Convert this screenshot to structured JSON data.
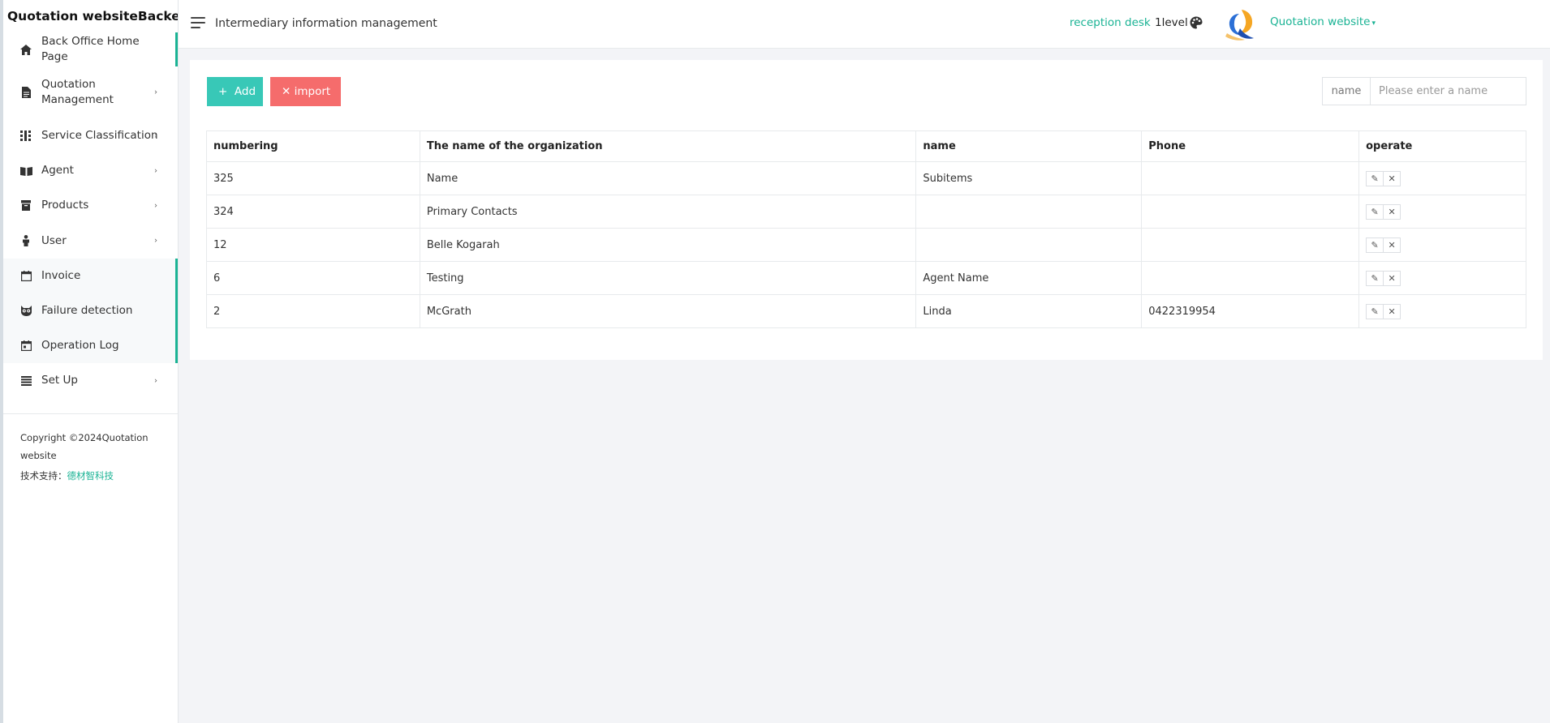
{
  "app": {
    "brand": "Quotation websiteBackend"
  },
  "sidebar": {
    "items": [
      {
        "label": "Back Office Home Page",
        "icon": "home-icon",
        "has_submenu": false
      },
      {
        "label": "Quotation Management",
        "icon": "document-icon",
        "has_submenu": true
      },
      {
        "label": "Service Classification",
        "icon": "columns-icon",
        "has_submenu": true
      },
      {
        "label": "Agent",
        "icon": "book-icon",
        "has_submenu": true
      },
      {
        "label": "Products",
        "icon": "archive-icon",
        "has_submenu": true
      },
      {
        "label": "User",
        "icon": "person-icon",
        "has_submenu": true
      },
      {
        "label": "Invoice",
        "icon": "calendar-icon",
        "has_submenu": false
      },
      {
        "label": "Failure detection",
        "icon": "owl-icon",
        "has_submenu": false
      },
      {
        "label": "Operation Log",
        "icon": "calendar-check-icon",
        "has_submenu": false
      },
      {
        "label": "Set Up",
        "icon": "list-icon",
        "has_submenu": true
      }
    ],
    "copyright": "Copyright ©2024Quotation website",
    "support_label": "技术支持：",
    "support_link": "德材智科技"
  },
  "topbar": {
    "page_title": "Intermediary information management",
    "reception_link": "reception desk",
    "level": "1level",
    "user_menu": "Quotation website"
  },
  "toolbar": {
    "add_label": "Add",
    "import_label": "import",
    "search_label": "name",
    "search_placeholder": "Please enter a name",
    "search_value": ""
  },
  "table": {
    "headers": [
      "numbering",
      "The name of the organization",
      "name",
      "Phone",
      "operate"
    ],
    "rows": [
      {
        "numbering": "325",
        "organization": "Name",
        "name": "Subitems",
        "phone": ""
      },
      {
        "numbering": "324",
        "organization": "Primary Contacts",
        "name": "",
        "phone": ""
      },
      {
        "numbering": "12",
        "organization": "Belle Kogarah",
        "name": "",
        "phone": ""
      },
      {
        "numbering": "6",
        "organization": "Testing",
        "name": "Agent Name",
        "phone": ""
      },
      {
        "numbering": "2",
        "organization": "McGrath",
        "name": "Linda",
        "phone": "0422319954"
      }
    ],
    "row_actions": [
      "edit-icon",
      "delete-icon"
    ]
  },
  "colors": {
    "accent": "#1ab394",
    "add_button": "#38c8b7",
    "import_button": "#f56c6c",
    "background": "#f3f4f7"
  }
}
